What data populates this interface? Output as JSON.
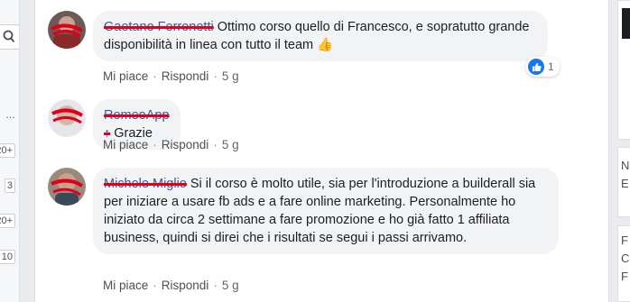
{
  "left_sidebar": {
    "ellipsis": "…",
    "badges": [
      "20+",
      "3",
      "20+",
      "10"
    ]
  },
  "comments": [
    {
      "author": "Gaetano Ferronetti",
      "text": "Ottimo corso quello di Francesco, e sopratutto grande disponibilità in linea con tutto il team",
      "emoji": "👍",
      "like_label": "Mi piace",
      "reply_label": "Rispondi",
      "time": "5 g",
      "reaction_count": "1"
    },
    {
      "author": "RomeoApp ↑",
      "text": "Grazie",
      "like_label": "Mi piace",
      "reply_label": "Rispondi",
      "time": "5 g"
    },
    {
      "author": "Michele Miglio",
      "text": "Si il corso è molto utile, sia per l'introduzione a builderall sia per iniziare a usare fb ads e a fare online marketing. Personalmente ho iniziato da circa 2 settimane a fare promozione e ho già fatto 1 affiliata business, quindi si direi che i risultati se segui i passi arrivamo.",
      "like_label": "Mi piace",
      "reply_label": "Rispondi",
      "time": "5 g"
    }
  ],
  "right_sidebar": {
    "letters_card1": [
      "N",
      "E"
    ],
    "letters_card2": [
      "F",
      "C",
      "F"
    ]
  },
  "colors": {
    "link_blue": "#385898",
    "strike_red": "#e0001b",
    "like_blue": "#1877f2",
    "bubble_bg": "#f2f3f5"
  }
}
